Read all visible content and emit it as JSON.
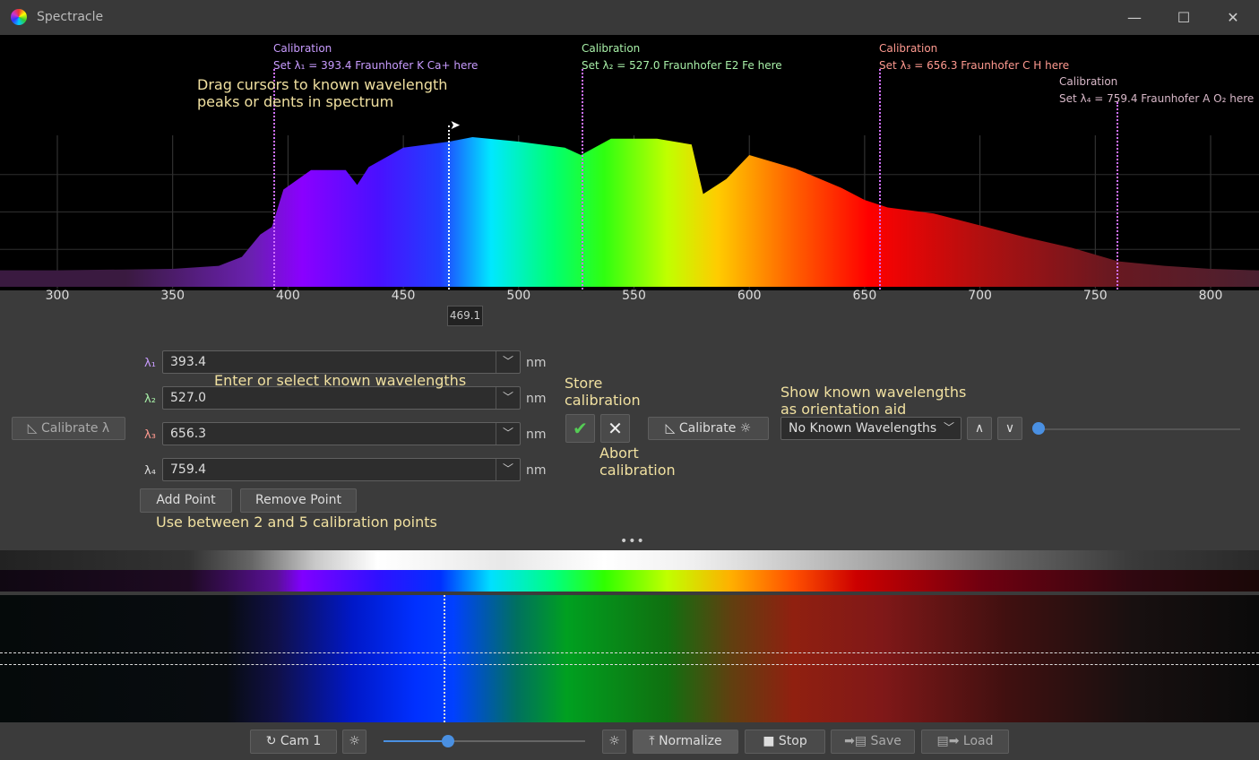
{
  "window": {
    "title": "Spectracle",
    "minimize": "—",
    "maximize": "☐",
    "close": "✕"
  },
  "plot": {
    "cursor_readout": "469.1",
    "drag_hint": [
      "Drag cursors to known wavelength",
      "peaks or dents in spectrum"
    ],
    "calibration_labels": [
      {
        "title": "Calibration",
        "text": "Set λ₁ = 393.4 Fraunhofer K Ca+ here",
        "color": "#c99cff"
      },
      {
        "title": "Calibration",
        "text": "Set λ₂ = 527.0 Fraunhofer E2 Fe here",
        "color": "#a8f0a8"
      },
      {
        "title": "Calibration",
        "text": "Set λ₃ = 656.3 Fraunhofer C H here",
        "color": "#ff9a90"
      },
      {
        "title": "Calibration",
        "text": "Set λ₄ = 759.4 Fraunhofer A O₂ here",
        "color": "#d8b8c8"
      }
    ]
  },
  "chart_data": {
    "type": "area",
    "title": "",
    "xlabel": "",
    "ylabel": "",
    "x_ticks": [
      "300",
      "350",
      "400",
      "450",
      "500",
      "550",
      "600",
      "650",
      "700",
      "750",
      "800"
    ],
    "xlim": [
      275,
      820
    ],
    "grid": true,
    "x": [
      275,
      300,
      350,
      370,
      380,
      388,
      393,
      398,
      410,
      425,
      430,
      435,
      450,
      470,
      480,
      500,
      520,
      527,
      540,
      560,
      575,
      580,
      590,
      600,
      620,
      640,
      650,
      660,
      680,
      700,
      720,
      740,
      760,
      780,
      800,
      820
    ],
    "y": [
      0.11,
      0.11,
      0.12,
      0.14,
      0.2,
      0.35,
      0.4,
      0.65,
      0.78,
      0.78,
      0.68,
      0.8,
      0.93,
      0.97,
      1.0,
      0.97,
      0.93,
      0.88,
      0.99,
      0.99,
      0.95,
      0.62,
      0.72,
      0.88,
      0.79,
      0.66,
      0.58,
      0.53,
      0.49,
      0.41,
      0.33,
      0.26,
      0.17,
      0.14,
      0.12,
      0.11
    ]
  },
  "calibration": {
    "points": [
      {
        "label": "λ₁",
        "value": "393.4",
        "unit": "nm",
        "color": "#c99cff"
      },
      {
        "label": "λ₂",
        "value": "527.0",
        "unit": "nm",
        "color": "#a8f0a8"
      },
      {
        "label": "λ₃",
        "value": "656.3",
        "unit": "nm",
        "color": "#ff9a90"
      },
      {
        "label": "λ₄",
        "value": "759.4",
        "unit": "nm",
        "color": "#dddddd"
      }
    ],
    "enter_hint": "Enter or select known wavelengths",
    "add_point": "Add Point",
    "remove_point": "Remove Point",
    "points_hint": "Use between 2 and 5 calibration points",
    "calibrate_lambda": "Calibrate λ",
    "store_hint": [
      "Store",
      "calibration"
    ],
    "abort_hint": [
      "Abort",
      "calibration"
    ],
    "calibrate_sun": "Calibrate",
    "known_hint": [
      "Show known wavelengths",
      "as orientation aid"
    ],
    "known_select": "No Known Wavelengths",
    "up": "∧",
    "down": "∨"
  },
  "toolbar": {
    "cam": "Cam 1",
    "normalize": "Normalize",
    "stop": "Stop",
    "save": "Save",
    "load": "Load",
    "exposure": 0.32
  }
}
